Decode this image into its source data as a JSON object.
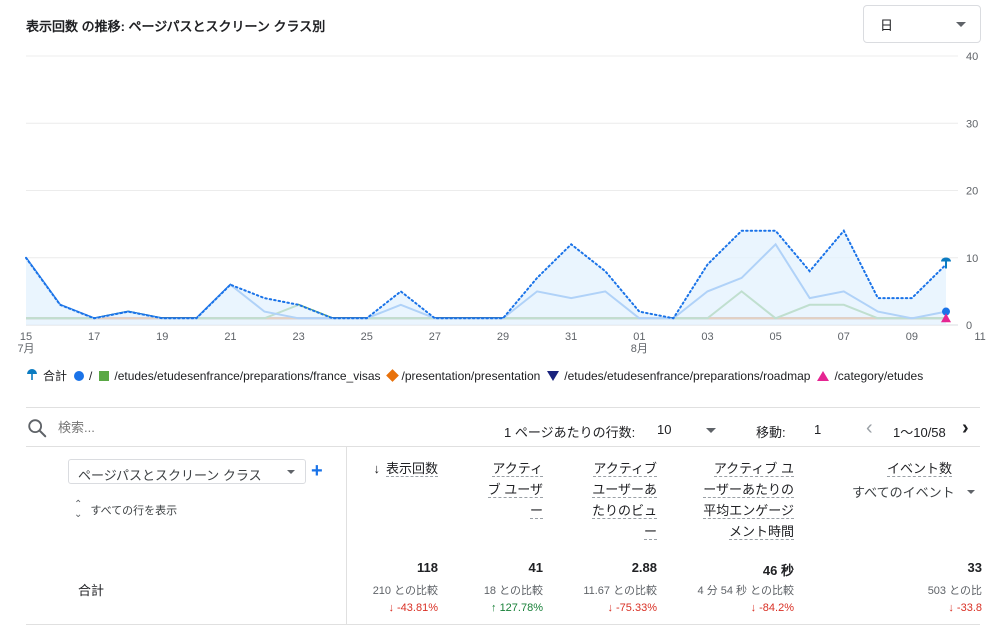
{
  "header": {
    "title": "表示回数 の推移: ページパスとスクリーン クラス別",
    "period": "日"
  },
  "chart_data": {
    "type": "line",
    "x": [
      "07-15",
      "07-16",
      "07-17",
      "07-18",
      "07-19",
      "07-20",
      "07-21",
      "07-22",
      "07-23",
      "07-24",
      "07-25",
      "07-26",
      "07-27",
      "07-28",
      "07-29",
      "07-30",
      "07-31",
      "08-01",
      "08-02",
      "08-03",
      "08-04",
      "08-05",
      "08-06",
      "08-07",
      "08-08",
      "08-09",
      "08-10",
      "08-11"
    ],
    "x_tick_labels": [
      "15",
      "17",
      "19",
      "21",
      "23",
      "25",
      "27",
      "29",
      "31",
      "01",
      "03",
      "05",
      "07",
      "09",
      "11"
    ],
    "x_month_labels": [
      {
        "day": "15",
        "month": "7月"
      },
      {
        "day": "01",
        "month": "8月"
      }
    ],
    "y_ticks": [
      "0",
      "10",
      "20",
      "30",
      "40"
    ],
    "ylim": [
      0,
      40
    ],
    "series": [
      {
        "name": "合計",
        "color": "#1a73e8",
        "style": "dotted-area",
        "values": [
          10,
          3,
          1,
          2,
          1,
          1,
          6,
          4,
          3,
          1,
          1,
          5,
          1,
          1,
          1,
          7,
          12,
          8,
          2,
          1,
          9,
          14,
          14,
          8,
          14,
          4,
          4,
          9
        ]
      },
      {
        "name": "/",
        "color": "#1a73e8",
        "style": "solid",
        "values": [
          10,
          3,
          1,
          2,
          1,
          1,
          6,
          2,
          1,
          1,
          1,
          3,
          1,
          1,
          1,
          5,
          4,
          5,
          1,
          1,
          5,
          7,
          12,
          4,
          5,
          2,
          1,
          2
        ]
      },
      {
        "name": "/etudes/etudesenfrance/preparations/france_visas",
        "color": "#5aa845",
        "style": "solid",
        "values": [
          1,
          1,
          1,
          2,
          1,
          1,
          1,
          1,
          3,
          1,
          1,
          1,
          1,
          1,
          1,
          1,
          1,
          1,
          1,
          1,
          1,
          5,
          1,
          3,
          3,
          1,
          1,
          1
        ]
      },
      {
        "name": "/presentation/presentation",
        "color": "#e8710a",
        "style": "solid",
        "values": [
          1,
          1,
          1,
          1,
          1,
          1,
          1,
          1,
          1,
          1,
          1,
          1,
          1,
          1,
          1,
          1,
          1,
          1,
          1,
          1,
          1,
          1,
          1,
          1,
          1,
          1,
          1,
          1
        ]
      },
      {
        "name": "/etudes/etudesenfrance/preparations/roadmap",
        "color": "#1a237e",
        "style": "solid",
        "values": [
          1,
          1,
          1,
          1,
          1,
          1,
          1,
          1,
          1,
          1,
          1,
          1,
          1,
          1,
          1,
          1,
          1,
          1,
          1,
          1,
          1,
          1,
          1,
          1,
          1,
          1,
          1,
          1
        ]
      },
      {
        "name": "/category/etudes",
        "color": "#e52592",
        "style": "solid",
        "values": [
          1,
          1,
          1,
          1,
          1,
          1,
          1,
          1,
          1,
          1,
          1,
          1,
          1,
          1,
          1,
          1,
          1,
          1,
          1,
          1,
          1,
          1,
          1,
          1,
          1,
          1,
          1,
          1
        ]
      }
    ]
  },
  "legend": [
    {
      "label": "合計",
      "marker": "pin",
      "color": "#0b7bc1"
    },
    {
      "label": "/",
      "marker": "circle",
      "color": "#1a73e8"
    },
    {
      "label": "/etudes/etudesenfrance/preparations/france_visas",
      "marker": "square",
      "color": "#5aa845"
    },
    {
      "label": "/presentation/presentation",
      "marker": "diamond",
      "color": "#e8710a"
    },
    {
      "label": "/etudes/etudesenfrance/preparations/roadmap",
      "marker": "triangle-down",
      "color": "#1a237e"
    },
    {
      "label": "/category/etudes",
      "marker": "triangle-up",
      "color": "#e52592"
    }
  ],
  "toolbar": {
    "search_placeholder": "検索...",
    "rows_label": "1 ページあたりの行数:",
    "rows_value": "10",
    "goto_label": "移動:",
    "goto_value": "1",
    "page_range": "1〜10/58"
  },
  "table": {
    "dimension": "ページパスとスクリーン クラス",
    "show_all": "すべての行を表示",
    "total_label": "合計",
    "columns": [
      {
        "lines": [
          "表示回数"
        ],
        "sorted": true,
        "value": "118",
        "compare": "210 との比較",
        "delta": "-43.81%",
        "dir": "down"
      },
      {
        "lines": [
          "アクティ",
          "ブ ユーザ",
          "ー"
        ],
        "value": "41",
        "compare": "18 との比較",
        "delta": "127.78%",
        "dir": "up"
      },
      {
        "lines": [
          "アクティブ",
          "ユーザーあ",
          "たりのビュ",
          "ー"
        ],
        "value": "2.88",
        "compare": "11.67 との比較",
        "delta": "-75.33%",
        "dir": "down"
      },
      {
        "lines": [
          "アクティブ ユ",
          "ーザーあたりの",
          "平均エンゲージ",
          "メント時間"
        ],
        "value": "46 秒",
        "compare": "4 分 54 秒 との比較",
        "delta": "-84.2%",
        "dir": "down"
      },
      {
        "lines": [
          "イベント数"
        ],
        "sub": "すべてのイベント",
        "value": "33",
        "compare": "503 との比",
        "delta": "-33.8",
        "dir": "down"
      }
    ],
    "arrows": {
      "down": "↓",
      "up": "↑",
      "sort": "↓"
    }
  }
}
